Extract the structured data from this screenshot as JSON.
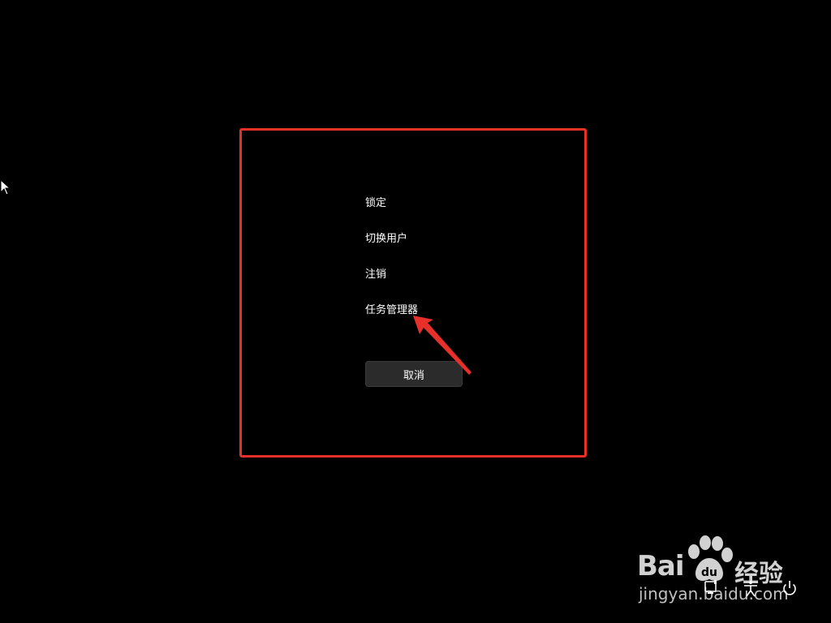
{
  "menu": {
    "items": [
      {
        "label": "锁定"
      },
      {
        "label": "切换用户"
      },
      {
        "label": "注销"
      },
      {
        "label": "任务管理器"
      }
    ]
  },
  "cancel_button": {
    "label": "取消"
  },
  "annotation": {
    "box_color": "#e8302a",
    "arrow_color": "#e8302a"
  },
  "watermark": {
    "brand": "Bai",
    "brand_suffix": "经验",
    "url": "jingyan.baidu.com"
  },
  "system_icons": [
    "network-icon",
    "accessibility-icon",
    "power-icon"
  ]
}
